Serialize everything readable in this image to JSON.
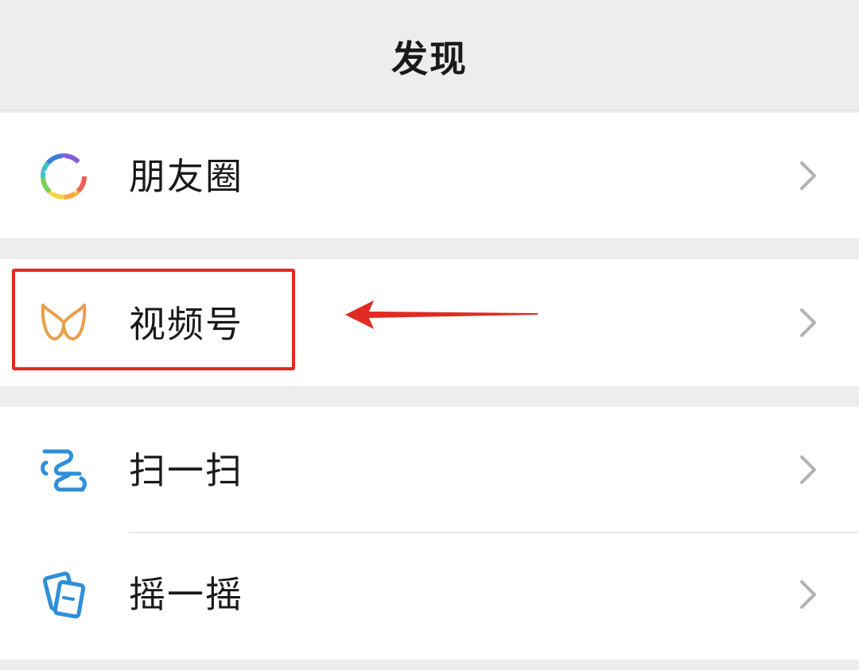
{
  "header": {
    "title": "发现"
  },
  "menu": {
    "items": [
      {
        "label": "朋友圈",
        "icon": "moments-aperture-icon"
      },
      {
        "label": "视频号",
        "icon": "channels-butterfly-icon"
      },
      {
        "label": "扫一扫",
        "icon": "scan-icon"
      },
      {
        "label": "摇一摇",
        "icon": "shake-icon"
      }
    ]
  },
  "annotation": {
    "highlight_color": "#e02a24",
    "arrow_color": "#e02a24"
  },
  "colors": {
    "background": "#ededed",
    "row_background": "#ffffff",
    "text": "#1a1a1a",
    "chevron": "#b2b2b2",
    "channels_icon": "#e8a04a",
    "scan_icon": "#2f8fd8"
  }
}
